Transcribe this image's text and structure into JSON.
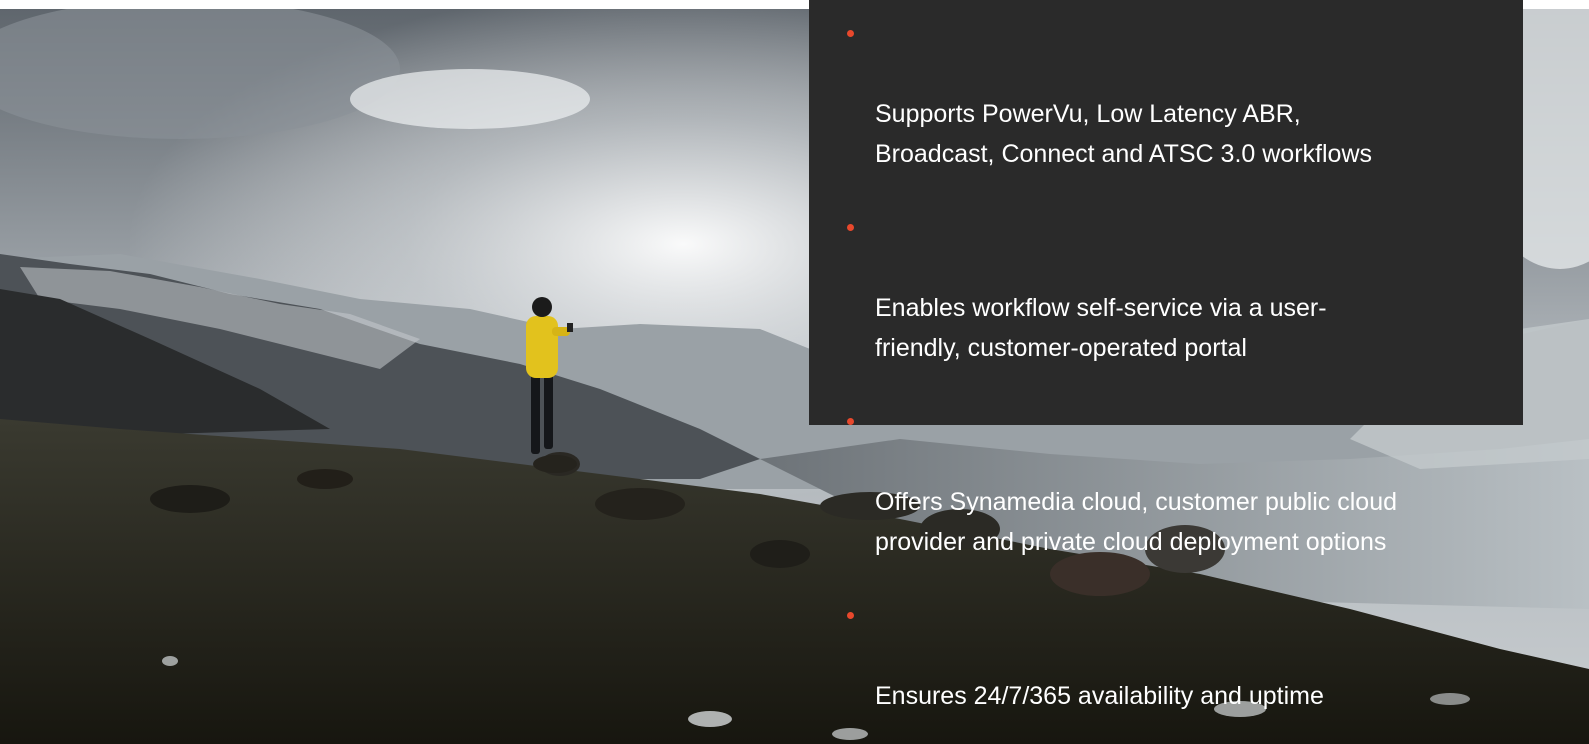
{
  "features": [
    {
      "text": "Supports PowerVu, Low Latency ABR,\nBroadcast, Connect and ATSC 3.0 workflows"
    },
    {
      "text": "Enables workflow self-service via a user-\nfriendly, customer-operated portal"
    },
    {
      "text": "Offers Synamedia cloud, customer public  cloud\nprovider and private cloud deployment  options"
    },
    {
      "text": "Ensures 24/7/365 availability and uptime"
    }
  ],
  "colors": {
    "panel_background": "#2a2a2a",
    "bullet": "#e8482c",
    "text": "#ffffff",
    "jacket": "#e2c21d"
  }
}
